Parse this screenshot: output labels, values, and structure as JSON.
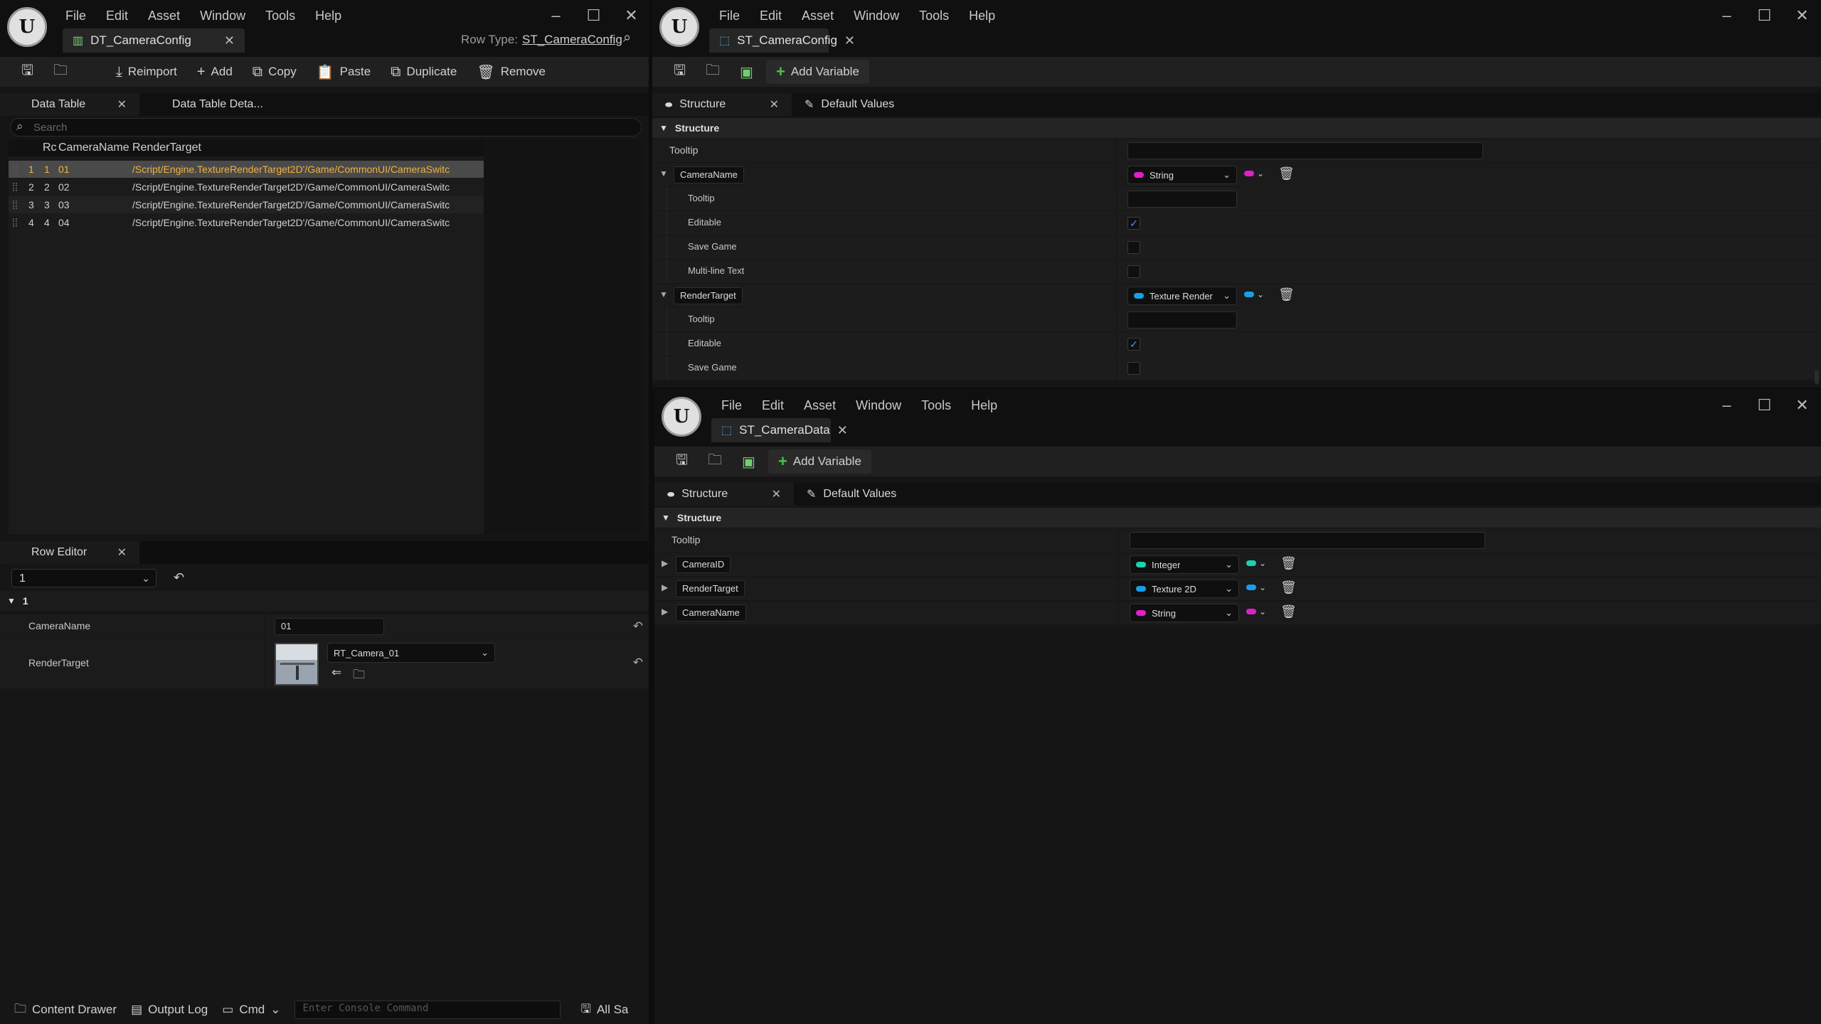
{
  "left_window": {
    "menu": [
      "File",
      "Edit",
      "Asset",
      "Window",
      "Tools",
      "Help"
    ],
    "tab_title": "DT_CameraConfig",
    "row_type_label": "Row Type:",
    "row_type_value": "ST_CameraConfig",
    "toolbar": {
      "reimport": "Reimport",
      "add": "Add",
      "copy": "Copy",
      "paste": "Paste",
      "duplicate": "Duplicate",
      "remove": "Remove"
    },
    "panel_tabs": {
      "data_table": "Data Table",
      "details": "Data Table Deta..."
    },
    "search_placeholder": "Search",
    "table_headers": {
      "row": "Rc",
      "camera_name": "CameraName",
      "render_target": "RenderTarget"
    },
    "rows": [
      {
        "index": "1",
        "row_name": "1",
        "camera_name": "01",
        "render_target": "/Script/Engine.TextureRenderTarget2D'/Game/CommonUI/CameraSwitc"
      },
      {
        "index": "2",
        "row_name": "2",
        "camera_name": "02",
        "render_target": "/Script/Engine.TextureRenderTarget2D'/Game/CommonUI/CameraSwitc"
      },
      {
        "index": "3",
        "row_name": "3",
        "camera_name": "03",
        "render_target": "/Script/Engine.TextureRenderTarget2D'/Game/CommonUI/CameraSwitc"
      },
      {
        "index": "4",
        "row_name": "4",
        "camera_name": "04",
        "render_target": "/Script/Engine.TextureRenderTarget2D'/Game/CommonUI/CameraSwitc"
      }
    ],
    "row_editor": {
      "tab": "Row Editor",
      "selected_row": "1",
      "section": "1",
      "camera_name_label": "CameraName",
      "camera_name_value": "01",
      "render_target_label": "RenderTarget",
      "render_target_value": "RT_Camera_01"
    },
    "bottom_bar": {
      "content_drawer": "Content Drawer",
      "output_log": "Output Log",
      "cmd": "Cmd",
      "console_placeholder": "Enter Console Command",
      "all_saved": "All Sa"
    }
  },
  "top_right_window": {
    "menu": [
      "File",
      "Edit",
      "Asset",
      "Window",
      "Tools",
      "Help"
    ],
    "tab_title": "ST_CameraConfig",
    "add_variable": "Add Variable",
    "panel_tabs": {
      "structure": "Structure",
      "defaults": "Default Values"
    },
    "section": "Structure",
    "tooltip_label": "Tooltip",
    "vars": [
      {
        "name": "CameraName",
        "type": "String",
        "pill_color": "#e020c8",
        "props": [
          {
            "label": "Tooltip",
            "kind": "text"
          },
          {
            "label": "Editable",
            "kind": "check",
            "checked": true
          },
          {
            "label": "Save Game",
            "kind": "check",
            "checked": false
          },
          {
            "label": "Multi-line Text",
            "kind": "check",
            "checked": false
          }
        ]
      },
      {
        "name": "RenderTarget",
        "type": "Texture Render",
        "pill_color": "#1a9ee8",
        "props": [
          {
            "label": "Tooltip",
            "kind": "text"
          },
          {
            "label": "Editable",
            "kind": "check",
            "checked": true
          },
          {
            "label": "Save Game",
            "kind": "check",
            "checked": false
          }
        ]
      }
    ]
  },
  "bottom_right_window": {
    "menu": [
      "File",
      "Edit",
      "Asset",
      "Window",
      "Tools",
      "Help"
    ],
    "tab_title": "ST_CameraData",
    "add_variable": "Add Variable",
    "panel_tabs": {
      "structure": "Structure",
      "defaults": "Default Values"
    },
    "section": "Structure",
    "tooltip_label": "Tooltip",
    "vars": [
      {
        "name": "CameraID",
        "type": "Integer",
        "pill_color": "#20d0b0"
      },
      {
        "name": "RenderTarget",
        "type": "Texture 2D",
        "pill_color": "#1a9ee8"
      },
      {
        "name": "CameraName",
        "type": "String",
        "pill_color": "#e020c8"
      }
    ]
  }
}
